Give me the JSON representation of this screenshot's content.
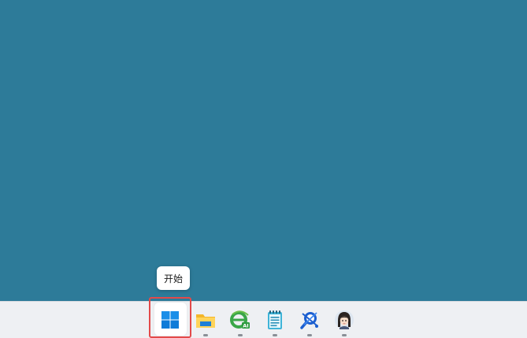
{
  "tooltip": {
    "text": "开始"
  },
  "taskbar": {
    "items": [
      {
        "id": "start",
        "icon": "windows-logo-icon",
        "running": false
      },
      {
        "id": "file-explorer",
        "icon": "folder-icon",
        "running": true
      },
      {
        "id": "browser",
        "icon": "browser-ai-icon",
        "running": true,
        "badge": "AI"
      },
      {
        "id": "notepad",
        "icon": "notepad-icon",
        "running": true
      },
      {
        "id": "search-tool",
        "icon": "magnifier-tool-icon",
        "running": true
      },
      {
        "id": "avatar-app",
        "icon": "avatar-girl-icon",
        "running": true
      }
    ]
  },
  "colors": {
    "desktop_bg": "#2d7b99",
    "taskbar_bg": "#eef0f3",
    "highlight": "#e34a4a"
  }
}
